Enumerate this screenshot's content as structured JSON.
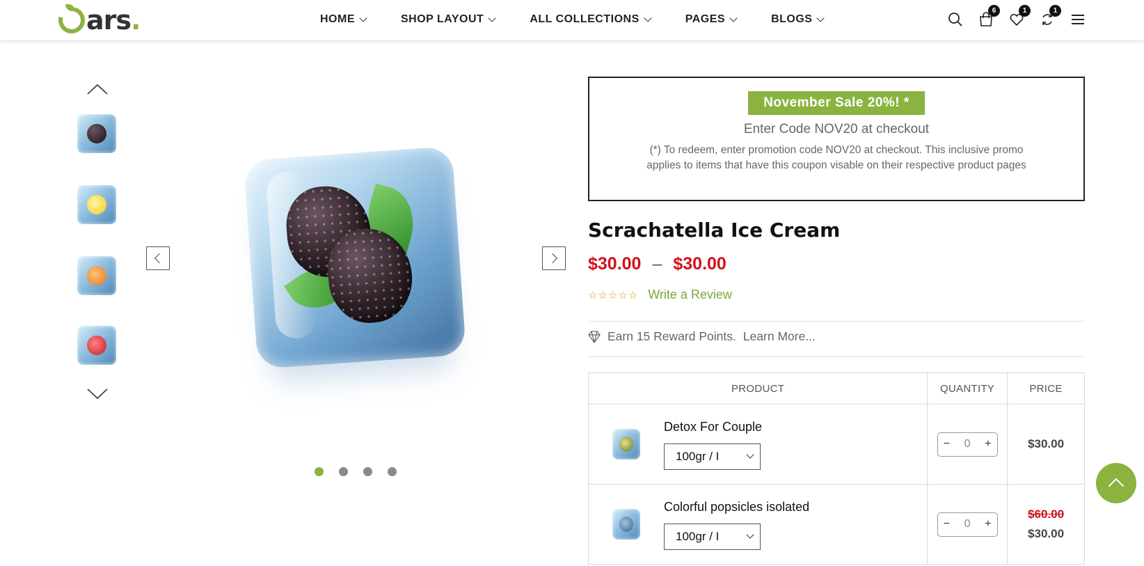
{
  "header": {
    "logo_text": "ars",
    "logo_dot": ".",
    "nav": [
      {
        "label": "HOME"
      },
      {
        "label": "SHOP LAYOUT"
      },
      {
        "label": "ALL COLLECTIONS"
      },
      {
        "label": "PAGES"
      },
      {
        "label": "BLOGS"
      }
    ],
    "icons": {
      "cart_count": "6",
      "wishlist_count": "1",
      "compare_count": "1"
    }
  },
  "gallery": {
    "thumbs": [
      "blackberry",
      "lemon",
      "apricot",
      "strawberry"
    ],
    "dots": 4,
    "active_dot": 0
  },
  "promo": {
    "badge": "November Sale 20%! *",
    "code_line": "Enter Code NOV20 at checkout",
    "note": "(*) To redeem, enter promotion code NOV20 at checkout. This inclusive promo applies to items that have this coupon visable on their respective product pages"
  },
  "product": {
    "title": "Scrachatella Ice Cream",
    "price_low": "$30.00",
    "price_sep": "–",
    "price_high": "$30.00",
    "stars": "☆☆☆☆☆",
    "review_link": "Write a Review",
    "reward_text": "Earn 15 Reward Points.",
    "reward_link": "Learn More..."
  },
  "table": {
    "headers": {
      "product": "PRODUCT",
      "quantity": "QUANTITY",
      "price": "PRICE"
    },
    "rows": [
      {
        "name": "Detox For Couple",
        "option": "100gr / I",
        "qty": "0",
        "price": "$30.00",
        "old_price": ""
      },
      {
        "name": "Colorful popsicles isolated",
        "option": "100gr / I",
        "qty": "0",
        "price": "$30.00",
        "old_price": "$60.00"
      }
    ],
    "minus": "−",
    "plus": "+"
  },
  "colors": {
    "accent": "#8ab33f",
    "sale": "#d0111b"
  }
}
